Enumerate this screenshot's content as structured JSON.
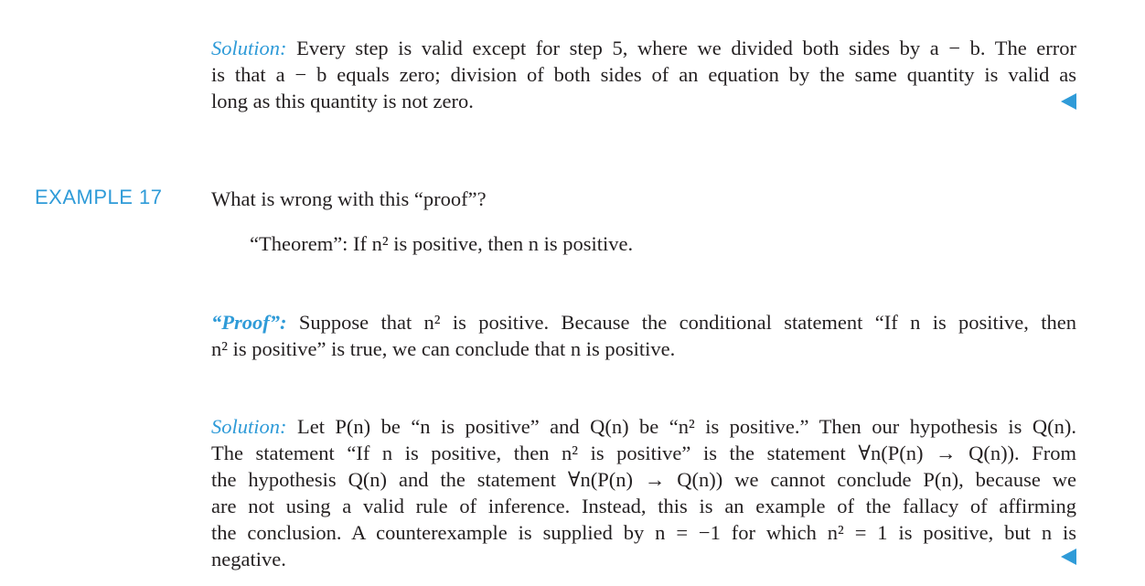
{
  "solution1": {
    "heading": "Solution:",
    "lines": [
      "Every step is valid except for step 5, where we divided both sides by a − b. The error",
      "is that a − b equals zero; division of both sides of an equation by the same quantity is valid as",
      "long as this quantity is not zero."
    ]
  },
  "example": {
    "label": "EXAMPLE 17",
    "question": "What is wrong with this “proof”?",
    "theorem": "“Theorem”:  If n² is positive, then n is positive."
  },
  "proof": {
    "heading": "“Proof”:",
    "lines": [
      "Suppose that n² is positive. Because the conditional statement “If n is positive, then",
      "n² is positive” is true, we can conclude that n is positive."
    ]
  },
  "solution2": {
    "heading": "Solution:",
    "lines": [
      "Let P(n) be “n is positive” and Q(n) be “n² is positive.” Then our hypothesis is Q(n).",
      "The statement “If n is positive, then n² is positive” is the statement ∀n(P(n) → Q(n)). From",
      "the hypothesis Q(n) and the statement ∀n(P(n) → Q(n)) we cannot conclude P(n), because we",
      "are not using a valid rule of inference. Instead, this is an example of the fallacy of affirming",
      "the conclusion. A counterexample is supplied by n = −1 for which n² = 1 is positive, but n is",
      "negative."
    ]
  },
  "colors": {
    "accent": "#2f9bd8",
    "text": "#231f20"
  },
  "icons": {
    "end_of_solution": "left-triangle-icon"
  }
}
